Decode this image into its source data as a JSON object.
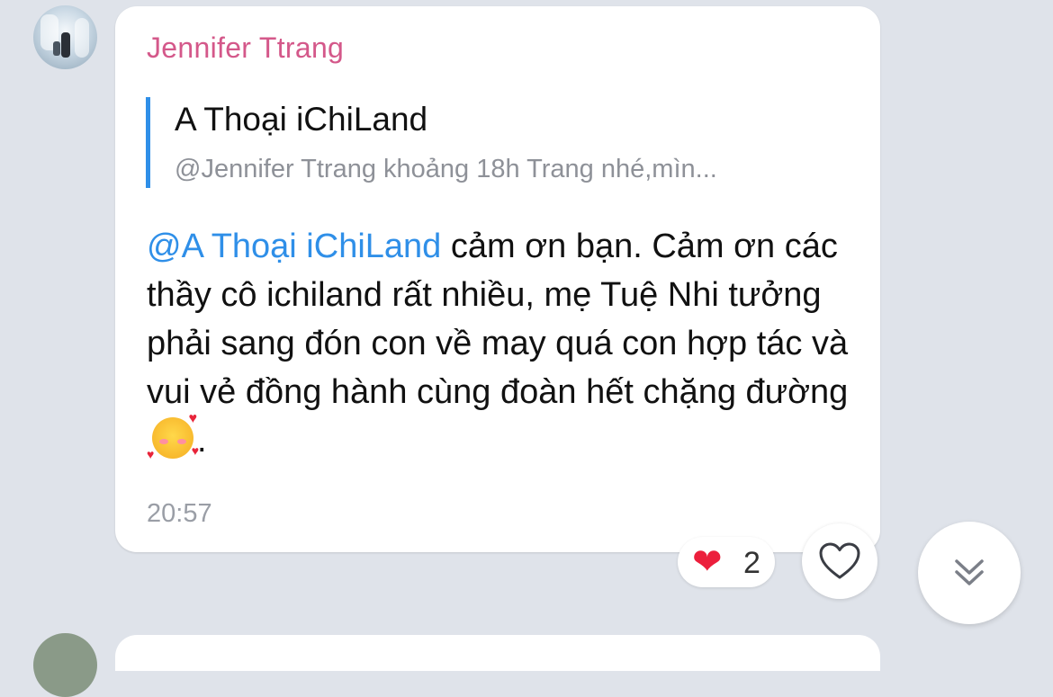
{
  "message": {
    "sender": "Jennifer Ttrang",
    "quote": {
      "author": "A Thoại iChiLand",
      "preview": "@Jennifer Ttrang khoảng 18h Trang nhé,mìn..."
    },
    "mention": "@A Thoại iChiLand",
    "text": " cảm ơn bạn. Cảm ơn các thầy cô ichiland rất nhiều, mẹ Tuệ Nhi tưởng phải sang đón con về may quá con hợp tác và vui vẻ đồng hành cùng đoàn hết chặng đường",
    "text_end": ".",
    "emoji": "smiling-face-with-hearts",
    "time": "20:57"
  },
  "reaction": {
    "emoji": "❤️",
    "count": "2"
  },
  "icons": {
    "like": "heart-outline-icon",
    "scroll": "double-chevron-down-icon"
  },
  "colors": {
    "background": "#dfe3ea",
    "sender_name": "#d4588a",
    "accent_blue": "#2f8fe8",
    "reaction_heart": "#ec1f3c"
  }
}
